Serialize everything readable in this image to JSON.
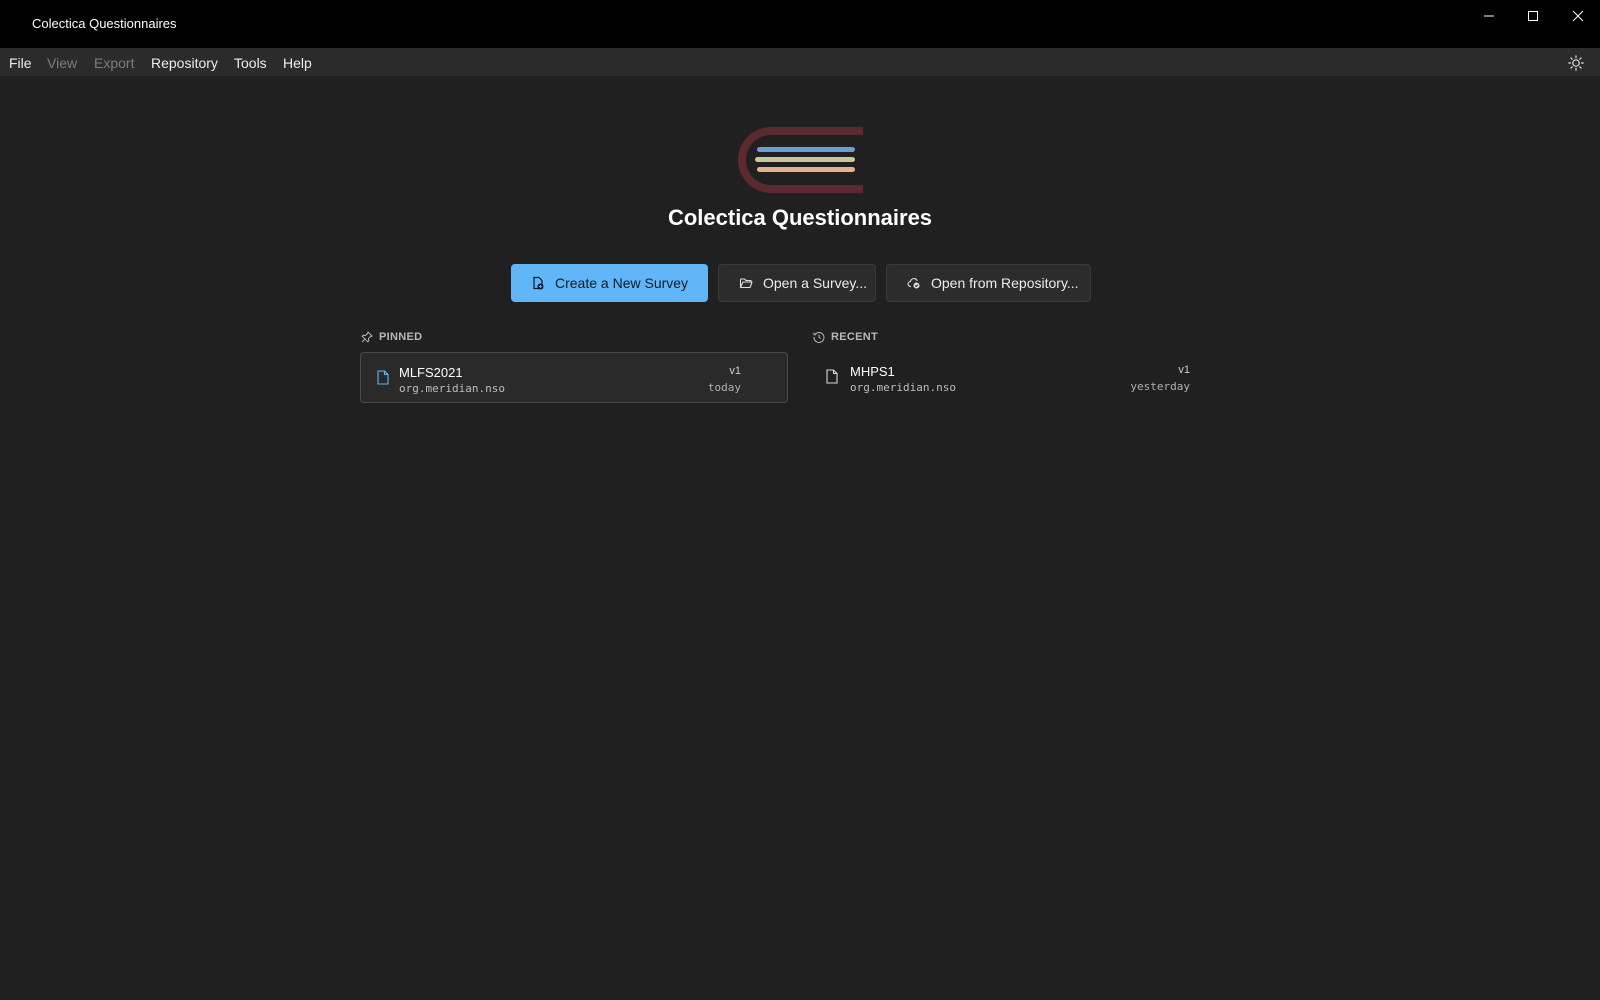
{
  "window": {
    "title": "Colectica Questionnaires",
    "controls": [
      "minimize-icon",
      "maximize-icon",
      "close-icon"
    ]
  },
  "menu": {
    "items": [
      {
        "label": "File",
        "enabled": true
      },
      {
        "label": "View",
        "enabled": false
      },
      {
        "label": "Export",
        "enabled": false
      },
      {
        "label": "Repository",
        "enabled": true
      },
      {
        "label": "Tools",
        "enabled": true
      },
      {
        "label": "Help",
        "enabled": true
      }
    ],
    "theme_icon": "sun-icon"
  },
  "welcome": {
    "app_title": "Colectica Questionnaires",
    "logo_colors": {
      "outline": "#5a2a2e",
      "stripe1": "#6b9fd1",
      "stripe2": "#c7c79a",
      "stripe3": "#e8b08c"
    },
    "actions": {
      "create": {
        "label": "Create a New Survey",
        "icon": "new-survey-icon"
      },
      "open": {
        "label": "Open a Survey...",
        "icon": "folder-open-icon"
      },
      "open_repo": {
        "label": "Open from Repository...",
        "icon": "cloud-repository-icon"
      }
    },
    "accent_color": "#60b6f7"
  },
  "pinned": {
    "label": "PINNED",
    "icon": "pin-icon",
    "items": [
      {
        "name": "MLFS2021",
        "agency": "org.meridian.nso",
        "version": "v1",
        "when": "today"
      }
    ]
  },
  "recent": {
    "label": "RECENT",
    "icon": "history-icon",
    "items": [
      {
        "name": "MHPS1",
        "agency": "org.meridian.nso",
        "version": "v1",
        "when": "yesterday"
      }
    ]
  }
}
